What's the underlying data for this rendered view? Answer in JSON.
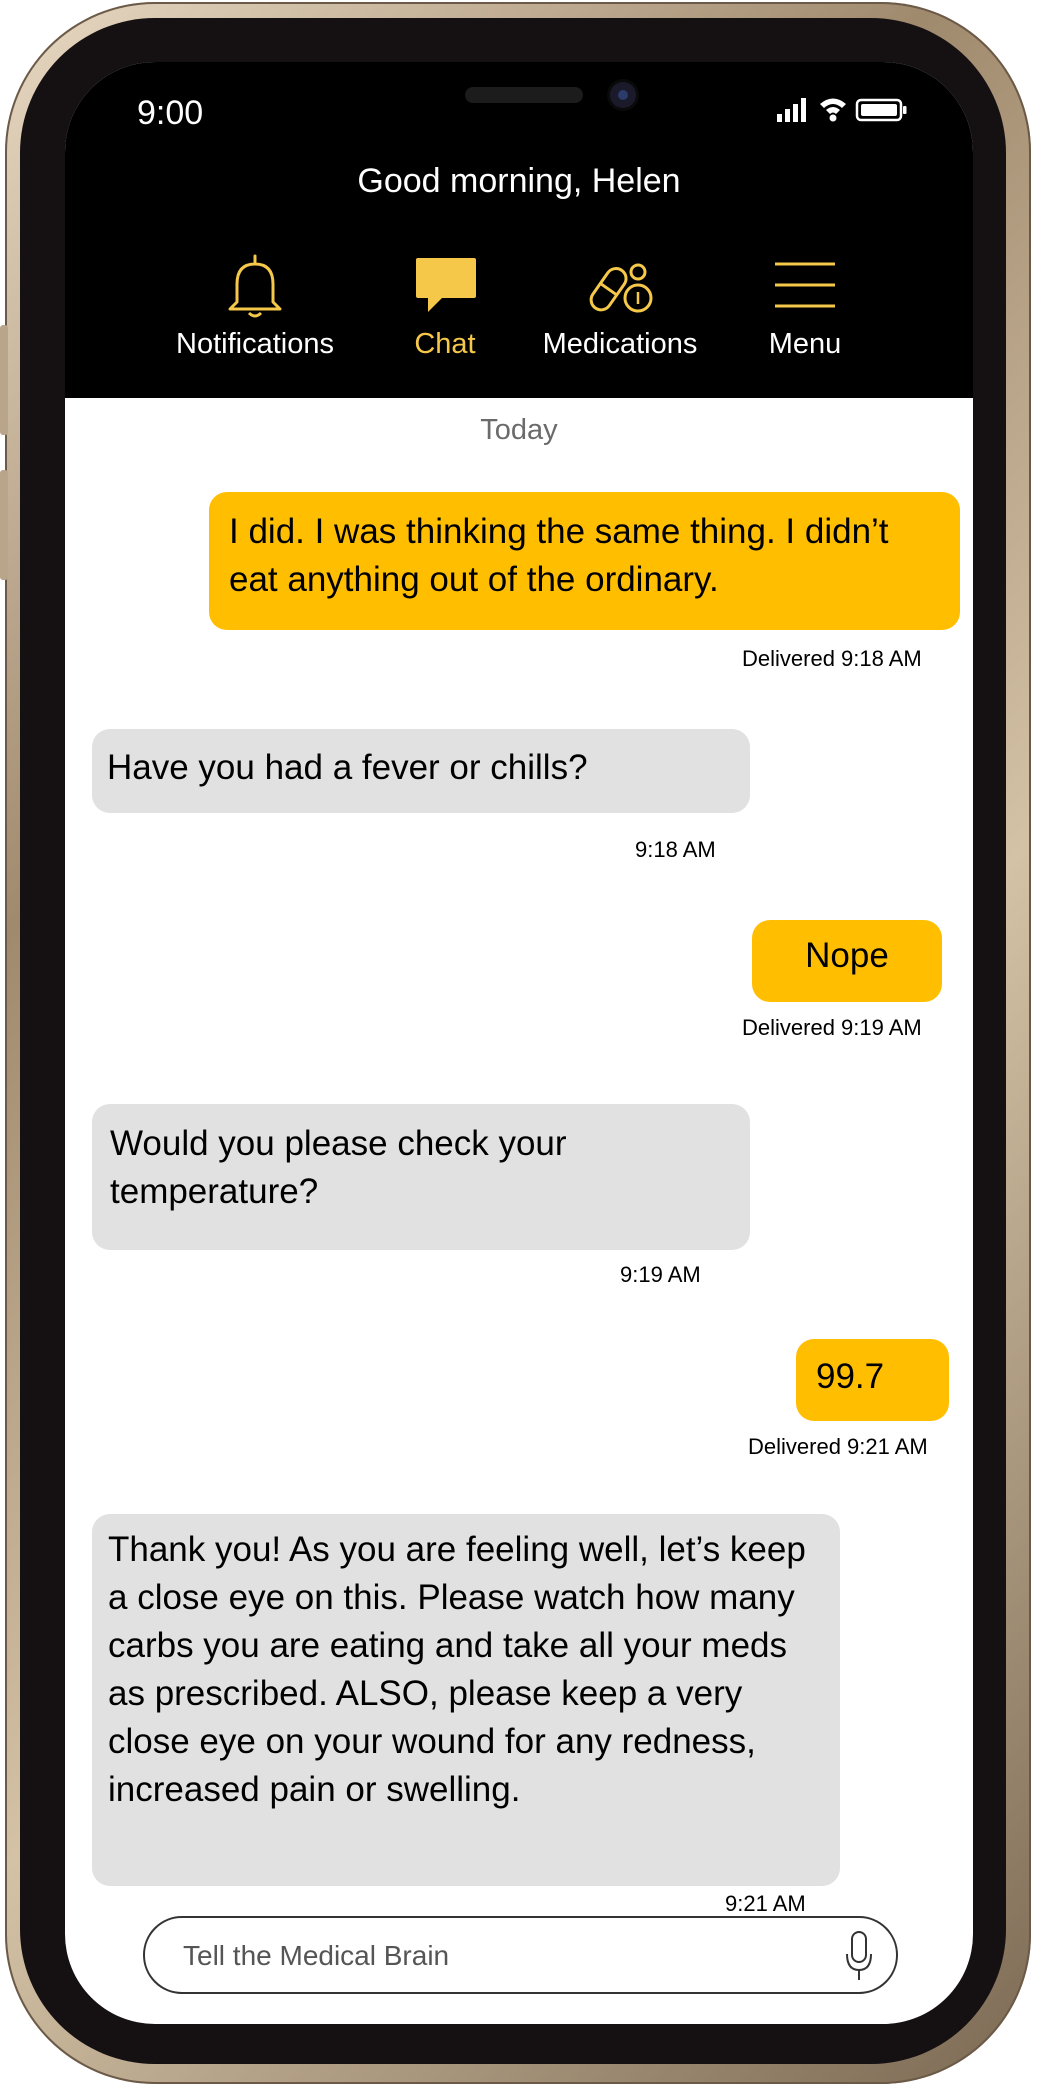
{
  "status_bar": {
    "time": "9:00"
  },
  "header": {
    "greeting": "Good morning, Helen"
  },
  "nav": {
    "items": [
      {
        "label": "Notifications",
        "icon": "bell-icon",
        "active": false
      },
      {
        "label": "Chat",
        "icon": "chat-bubble-icon",
        "active": true
      },
      {
        "label": "Medications",
        "icon": "pill-icon",
        "active": false
      },
      {
        "label": "Menu",
        "icon": "hamburger-icon",
        "active": false
      }
    ]
  },
  "chat": {
    "date_label": "Today",
    "messages": [
      {
        "direction": "outgoing",
        "text": "I did. I was thinking the same thing. I didn’t eat anything out of the ordinary.",
        "meta": "Delivered 9:18 AM"
      },
      {
        "direction": "incoming",
        "text": "Have you had a fever or chills?",
        "meta": "9:18 AM"
      },
      {
        "direction": "outgoing",
        "text": "Nope",
        "meta": "Delivered 9:19 AM"
      },
      {
        "direction": "incoming",
        "text": "Would you please check your temperature?",
        "meta": "9:19 AM"
      },
      {
        "direction": "outgoing",
        "text": "99.7",
        "meta": "Delivered 9:21 AM"
      },
      {
        "direction": "incoming",
        "text": "Thank you! As you are feeling well, let’s keep a close eye on this.  Please watch how many carbs you are eating and take all your meds as prescribed. ALSO, please keep a very close eye on your wound for any redness, increased pain or swelling.",
        "meta": "9:21 AM"
      }
    ]
  },
  "composer": {
    "placeholder": "Tell the Medical Brain",
    "mic_icon": "microphone-icon"
  },
  "colors": {
    "accent": "#ffbf00",
    "active_nav": "#f5c84a",
    "incoming_bubble": "#e1e1e1",
    "header_bg": "#000000"
  }
}
